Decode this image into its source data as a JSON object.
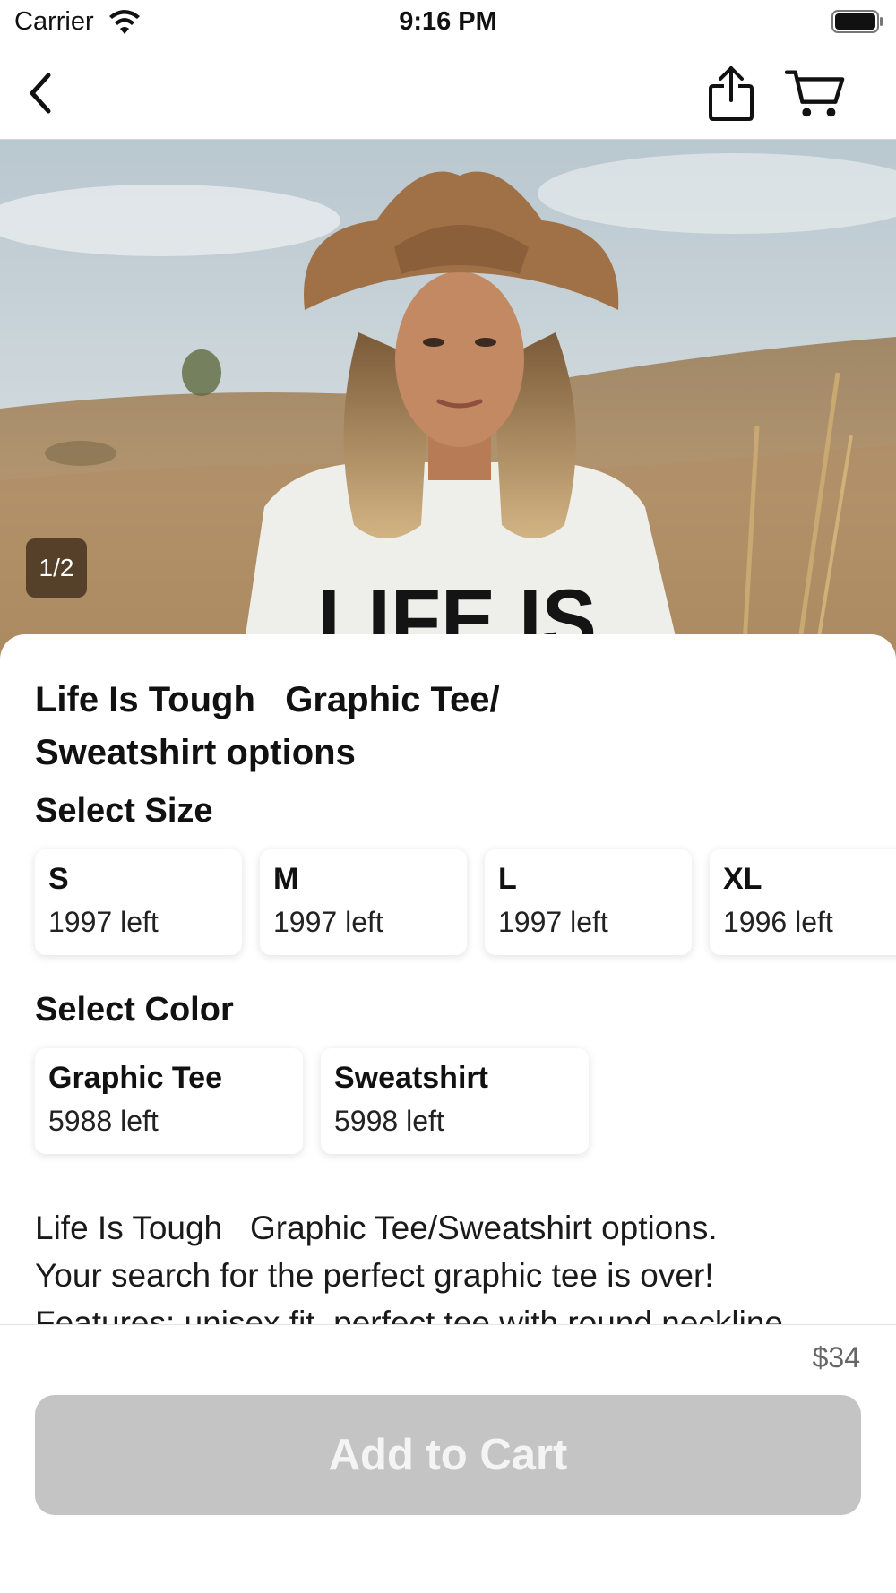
{
  "status_bar": {
    "carrier": "Carrier",
    "time": "9:16 PM"
  },
  "nav": {
    "back_icon": "chevron-left-icon",
    "share_icon": "share-icon",
    "cart_icon": "cart-icon"
  },
  "hero": {
    "image_counter": "1/2",
    "shirt_print": "LIFE IS"
  },
  "product": {
    "title": "Life Is Tough   Graphic Tee/\nSweatshirt options",
    "size_label": "Select Size",
    "sizes": [
      {
        "name": "S",
        "stock": "1997 left"
      },
      {
        "name": "M",
        "stock": "1997 left"
      },
      {
        "name": "L",
        "stock": "1997 left"
      },
      {
        "name": "XL",
        "stock": "1996 left"
      }
    ],
    "color_label": "Select Color",
    "colors": [
      {
        "name": "Graphic Tee",
        "stock": "5988 left"
      },
      {
        "name": "Sweatshirt",
        "stock": "5998 left"
      }
    ],
    "description": "Life Is Tough   Graphic Tee/Sweatshirt options.\nYour search for the perfect graphic tee is over!\nFeatures: unisex fit, perfect tee with round neckline"
  },
  "checkout": {
    "price": "$34",
    "add_to_cart_label": "Add to Cart",
    "button_color": "#c4c4c4"
  }
}
